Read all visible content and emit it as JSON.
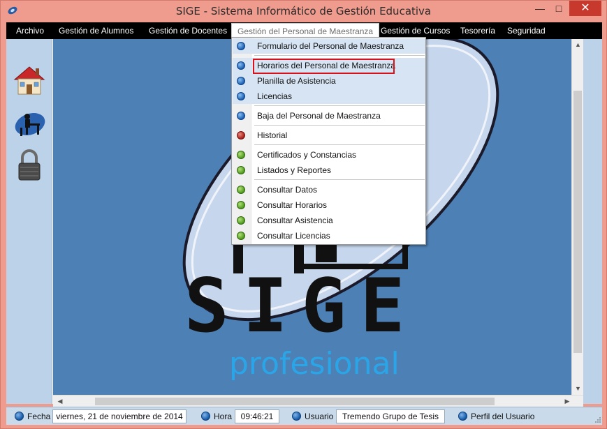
{
  "window": {
    "title": "SIGE - Sistema Informático de Gestión Educativa",
    "minimize": "—",
    "maximize": "□",
    "close": "✕"
  },
  "menubar": {
    "items": [
      {
        "label": "Archivo"
      },
      {
        "label": "Gestión de  Alumnos"
      },
      {
        "label": "Gestión de Docentes"
      },
      {
        "label": "Gestión del Personal de Maestranza"
      },
      {
        "label": "Gestión de Cursos"
      },
      {
        "label": "Tesorería"
      },
      {
        "label": "Seguridad"
      }
    ]
  },
  "sidebar": {
    "icons": [
      "home-icon",
      "student-desk-icon",
      "padlock-icon"
    ]
  },
  "dropdown": {
    "items": [
      {
        "label": "Formulario del Personal de Maestranza",
        "dot": "blue"
      },
      {
        "label": "Horarios del Personal de Maestranza",
        "dot": "blue"
      },
      {
        "label": "Planilla de Asistencia",
        "dot": "blue"
      },
      {
        "label": "Licencias",
        "dot": "blue"
      },
      {
        "label": "Baja del Personal de Maestranza",
        "dot": "blue"
      },
      {
        "label": "Historial",
        "dot": "red"
      },
      {
        "label": "Certificados y Constancias",
        "dot": "green"
      },
      {
        "label": "Listados y Reportes",
        "dot": "green"
      },
      {
        "label": "Consultar Datos",
        "dot": "green"
      },
      {
        "label": "Consultar Horarios",
        "dot": "green"
      },
      {
        "label": "Consultar Asistencia",
        "dot": "green"
      },
      {
        "label": "Consultar Licencias",
        "dot": "green"
      }
    ]
  },
  "background_logo": {
    "title": "SIGE",
    "subtitle": "profesional"
  },
  "statusbar": {
    "fecha_label": "Fecha",
    "fecha_value": "viernes, 21 de noviembre de 2014",
    "hora_label": "Hora",
    "hora_value": "09:46:21",
    "usuario_label": "Usuario",
    "usuario_value": "Tremendo Grupo de Tesis",
    "perfil_label": "Perfil del Usuario"
  },
  "colors": {
    "window_frame": "#ef9c8f",
    "menubar": "#000000",
    "workspace": "#4d80b5",
    "sidebar": "#bcd2e8",
    "highlight_box": "#d8121a"
  }
}
